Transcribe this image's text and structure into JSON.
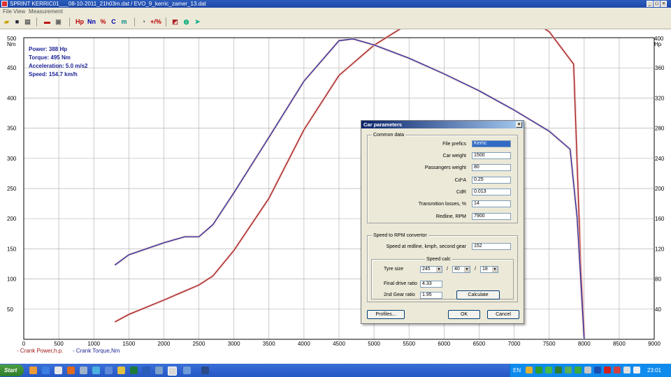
{
  "window": {
    "title": "SPRINT  KERRIC01___08-10-2011_21h03m.dat / EVO_9_kerric_zamer_13.dat"
  },
  "menu": [
    "File",
    "View",
    "Measurement"
  ],
  "toolbar": {
    "hp": "Hp",
    "nm": "Nn",
    "pct": "%",
    "c": "C",
    "m": "m",
    "plus_pct": "+/%"
  },
  "chart_data": {
    "type": "line",
    "xlabel": "",
    "ylabel": "Nm",
    "y2label": "Hp",
    "xlim": [
      0,
      9000
    ],
    "ylim": [
      0,
      500
    ],
    "y2lim": [
      0,
      400
    ],
    "x_ticks": [
      0,
      500,
      1000,
      1500,
      2000,
      2500,
      3000,
      3500,
      4000,
      4500,
      5000,
      5500,
      6000,
      6500,
      7000,
      7500,
      8000,
      8500,
      9000
    ],
    "y_ticks": [
      50,
      100,
      150,
      200,
      250,
      300,
      350,
      400,
      450,
      500
    ],
    "y2_ticks": [
      40,
      80,
      120,
      160,
      200,
      240,
      280,
      320,
      360,
      400
    ],
    "grid": true,
    "legend": "bottom-left",
    "series": [
      {
        "name": "Crank Power,h.p.",
        "axis": "right",
        "color": "#a01818",
        "x": [
          1300,
          1500,
          2000,
          2500,
          2700,
          3000,
          3500,
          4000,
          4500,
          5000,
          5500,
          6000,
          6500,
          6800,
          7000,
          7500,
          7850,
          7950,
          8000
        ],
        "y": [
          23,
          33,
          52,
          72,
          84,
          118,
          187,
          278,
          350,
          390,
          419,
          432,
          440,
          442,
          438,
          408,
          365,
          100,
          5
        ]
      },
      {
        "name": "Crank Torque,Nm",
        "axis": "left",
        "color": "#1e2596",
        "x": [
          1300,
          1500,
          2000,
          2300,
          2500,
          2700,
          3000,
          3500,
          4000,
          4500,
          4700,
          5000,
          5500,
          6000,
          6500,
          7000,
          7500,
          7800,
          7900,
          8000
        ],
        "y": [
          123,
          140,
          160,
          170,
          170,
          190,
          243,
          335,
          428,
          495,
          498,
          488,
          466,
          440,
          412,
          380,
          345,
          315,
          200,
          0
        ]
      }
    ],
    "annotations": {
      "power": "Power: 388 Hp",
      "torque": "Torque: 495 Nm",
      "accel": "Acceleration: 5.0 m/s2",
      "speed": "Speed: 154.7 km/h"
    }
  },
  "dialog": {
    "title": "Car parameters",
    "common": {
      "group": "Common data",
      "fields": [
        {
          "label": "File prefics",
          "value": "Kerric"
        },
        {
          "label": "Car weight",
          "value": "1500"
        },
        {
          "label": "Passangers weight",
          "value": "80"
        },
        {
          "label": "Cd*A",
          "value": "0.25"
        },
        {
          "label": "CdR",
          "value": "0.013"
        },
        {
          "label": "Transmition losses, %",
          "value": "14"
        },
        {
          "label": "Redline, RPM",
          "value": "7900"
        }
      ]
    },
    "rpm": {
      "group": "Speed to RPM convertor",
      "speed_label": "Speed at redline, kmph, second gear",
      "speed_value": "152",
      "calc_group": "Speed calc",
      "tyre_label": "Tyre size",
      "tyre_width": "245",
      "tyre_profile": "40",
      "tyre_rim": "18",
      "sep": "/",
      "final_label": "Final drive ratio",
      "final_value": "4.33",
      "gear_label": "2nd Gear ratio",
      "gear_value": "1.95",
      "calculate": "Calculate"
    },
    "buttons": {
      "profiles": "Profiles...",
      "ok": "OK",
      "cancel": "Cancel"
    }
  },
  "legend": {
    "power": "- Crank Power,h.p.",
    "torque": "- Crank Torque,Nm"
  },
  "taskbar": {
    "start": "Start",
    "lang": "EN",
    "clock": "23:01"
  }
}
